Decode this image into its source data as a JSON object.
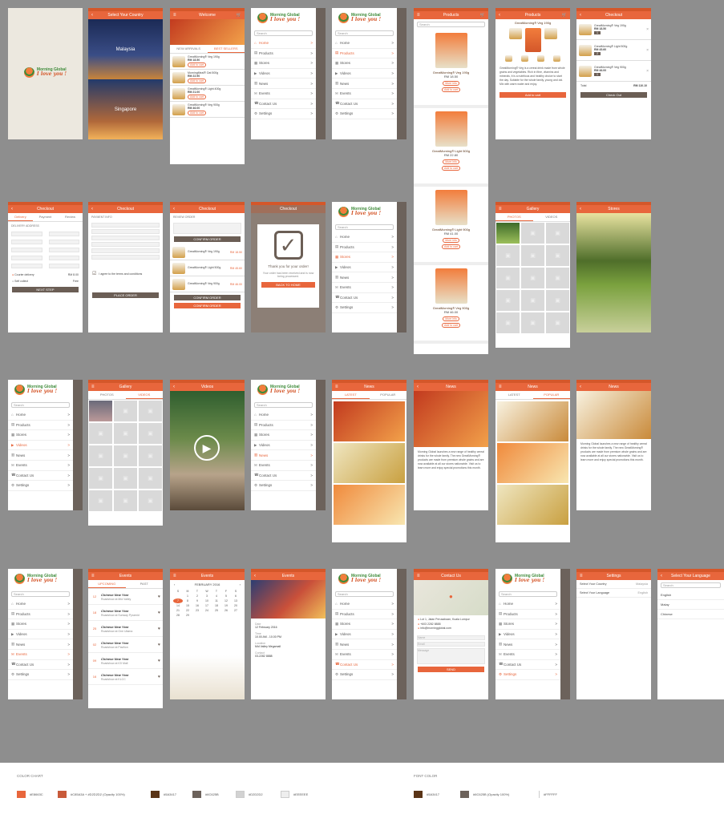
{
  "colors": {
    "primary": "#e8663c",
    "primary_dark": "#d4572a",
    "shade": "#6c625b",
    "brown": "#5a3417",
    "grey": "#d9d9d9"
  },
  "brand": {
    "name": "Morning Global",
    "tagline": "I love you !"
  },
  "common": {
    "search": "Search",
    "arrow": ">"
  },
  "screens": {
    "select_country": {
      "title": "Select Your Country",
      "countries": [
        "Malaysia",
        "Singapore"
      ]
    },
    "welcome": {
      "title": "Welcome",
      "tabs": [
        "NEW ARRIVALS",
        "BEST SELLERS"
      ],
      "products": [
        {
          "name": "GreatMorning® Veg 190g",
          "price": "RM 18.50"
        },
        {
          "name": "MorningMeal® Oat 500g",
          "price": "RM 22.90"
        },
        {
          "name": "GreatMorning® Light 400g",
          "price": "RM 21.00"
        },
        {
          "name": "GreatMorning® Veg 900g",
          "price": "RM 46.00"
        }
      ],
      "add_label": "Add to cart"
    },
    "menu_items": [
      {
        "icon": "home-icon",
        "glyph": "⌂",
        "label": "Home"
      },
      {
        "icon": "products-icon",
        "glyph": "▤",
        "label": "Products"
      },
      {
        "icon": "stores-icon",
        "glyph": "▦",
        "label": "Stores"
      },
      {
        "icon": "videos-icon",
        "glyph": "▶",
        "label": "Videos"
      },
      {
        "icon": "news-icon",
        "glyph": "▥",
        "label": "News"
      },
      {
        "icon": "events-icon",
        "glyph": "✉",
        "label": "Events"
      },
      {
        "icon": "contact-icon",
        "glyph": "☎",
        "label": "Contact Us"
      },
      {
        "icon": "settings-icon",
        "glyph": "⚙",
        "label": "Settings"
      }
    ],
    "products_list": {
      "title": "Products",
      "items": [
        {
          "name": "GreatMorning® Veg 190g",
          "price": "RM 18.50"
        },
        {
          "name": "GreatMorning® Light 500g",
          "price": "RM 22.80"
        },
        {
          "name": "GreatMorning® Light 900g",
          "price": "RM 41.00"
        },
        {
          "name": "GreatMorning® Veg 900g",
          "price": "RM 46.00"
        }
      ],
      "more_label": "More info",
      "buy_label": "Add to cart"
    },
    "product_detail": {
      "title": "Products",
      "name": "GreatMorning® Veg 190g",
      "desc": "GreatMorning® Veg is a cereal drink made from whole grains and vegetables. Rich in fibre, vitamins and minerals, it is a nutritious and healthy choice to start the day. Suitable for the whole family, young and old. Mix with warm water and enjoy.",
      "cta": "Add to cart"
    },
    "checkout_cart": {
      "title": "Checkout",
      "items": [
        {
          "name": "GreatMorning® Veg 190g",
          "qty": "1",
          "price": "RM 18.50"
        },
        {
          "name": "GreatMorning® Light 500g",
          "qty": "2",
          "price": "RM 45.60"
        },
        {
          "name": "GreatMorning® Veg 900g",
          "qty": "1",
          "price": "RM 46.00"
        }
      ],
      "total_label": "Total",
      "total": "RM 110.10",
      "cta": "Check Out"
    },
    "checkout_delivery": {
      "title": "Checkout",
      "steps": [
        "Delivery",
        "Payment",
        "Review"
      ],
      "section": "DELIVERY ADDRESS",
      "options": [
        "Courier delivery",
        "Self collect"
      ],
      "option_prices": [
        "RM 8.00",
        "Free"
      ],
      "cta": "NEXT STEP"
    },
    "checkout_payment": {
      "title": "Checkout",
      "section": "PAYMENT INFO",
      "terms": "I agree to the terms and conditions",
      "cta": "PLACE ORDER"
    },
    "checkout_review": {
      "title": "Checkout",
      "section": "REVIEW ORDER",
      "cta": "CONFIRM ORDER"
    },
    "thanks": {
      "title": "Checkout",
      "message": "Thank you for your order!",
      "sub": "Your order has been received and is now being processed.",
      "cta": "BACK TO HOME"
    },
    "gallery": {
      "title": "Gallery",
      "tabs": [
        "PHOTOS",
        "VIDEOS"
      ]
    },
    "store_photo": {
      "title": "Stores"
    },
    "video": {
      "title": "Videos"
    },
    "news": {
      "title": "News",
      "tabs": [
        "LATEST",
        "POPULAR"
      ]
    },
    "news_detail": {
      "title": "News",
      "body": "Morning Global launches a new range of healthy cereal drinks for the whole family. The new GreatMorning® products are made from premium whole grains and are now available at all our stores nationwide. Visit us to learn more and enjoy special promotions this month."
    },
    "events": {
      "title": "Events",
      "tabs": [
        "UPCOMING",
        "PAST"
      ],
      "items": [
        {
          "day": "12",
          "name": "Chinese New Year",
          "sub": "Roadshow at Mid Valley"
        },
        {
          "day": "18",
          "name": "Chinese New Year",
          "sub": "Roadshow at Sunway Pyramid"
        },
        {
          "day": "25",
          "name": "Chinese New Year",
          "sub": "Roadshow at One Utama"
        },
        {
          "day": "02",
          "name": "Chinese New Year",
          "sub": "Roadshow at Pavilion"
        },
        {
          "day": "09",
          "name": "Chinese New Year",
          "sub": "Roadshow at IOI Mall"
        },
        {
          "day": "16",
          "name": "Chinese New Year",
          "sub": "Roadshow at KLCC"
        }
      ]
    },
    "calendar": {
      "title": "Events",
      "month": "FEBRUARY 2016",
      "days": [
        "S",
        "M",
        "T",
        "W",
        "T",
        "F",
        "S"
      ],
      "weeks": [
        [
          "",
          "1",
          "2",
          "3",
          "4",
          "5",
          "6"
        ],
        [
          "7",
          "8",
          "9",
          "10",
          "11",
          "12",
          "13"
        ],
        [
          "14",
          "15",
          "16",
          "17",
          "18",
          "19",
          "20"
        ],
        [
          "21",
          "22",
          "23",
          "24",
          "25",
          "26",
          "27"
        ],
        [
          "28",
          "29",
          "",
          "",
          "",
          "",
          ""
        ]
      ]
    },
    "event_detail": {
      "title": "Events",
      "rows": [
        {
          "label": "Date",
          "value": "12 February 2016"
        },
        {
          "label": "Time",
          "value": "10.00 AM - 10.00 PM"
        },
        {
          "label": "Location",
          "value": "Mid Valley Megamall"
        },
        {
          "label": "Contact",
          "value": "03-2282 8888"
        }
      ]
    },
    "contact": {
      "title": "Contact Us",
      "address": "Lot 1, Jalan Perusahaan, Kuala Lumpur",
      "phone": "+603 2282 8888",
      "email": "info@morningglobal.com",
      "fields": [
        "Name",
        "Email",
        "Message"
      ],
      "cta": "SEND"
    },
    "settings": {
      "title": "Settings",
      "rows": [
        {
          "label": "Select Your Country",
          "value": "Malaysia"
        },
        {
          "label": "Select Your Language",
          "value": "English"
        }
      ]
    },
    "language": {
      "title": "Select Your Language",
      "options": [
        "English",
        "Malay",
        "Chinese"
      ]
    }
  },
  "color_chart": {
    "title": "COLOR CHART",
    "swatches": [
      {
        "hex": "#E8663C",
        "label": "#E8663C"
      },
      {
        "hex": "#C85A3A",
        "label": "#C85A3A + #D2D2D2 (Opacity 100%)"
      },
      {
        "hex": "#5A3417",
        "label": "#5A3417"
      },
      {
        "hex": "#6C625B",
        "label": "#6C625B"
      },
      {
        "hex": "#D2D2D2",
        "label": "#D2D2D2"
      },
      {
        "hex": "#EEEEEE",
        "label": "#EEEEEE"
      }
    ]
  },
  "font_color": {
    "title": "FONT COLOR",
    "swatches": [
      {
        "hex": "#5A3417",
        "label": "#5A3417"
      },
      {
        "hex": "#6C625B",
        "label": "#6C625B (Opacity 100%)"
      },
      {
        "hex": "#FFFFFF",
        "label": "#FFFFFF"
      }
    ]
  }
}
